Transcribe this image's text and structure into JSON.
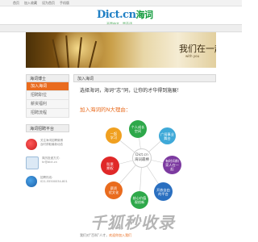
{
  "topnav": {
    "items": [
      "首页",
      "加入收藏",
      "设为首页",
      "手机版"
    ]
  },
  "logo": {
    "wordmark": "Dict.cn",
    "wordmark_cn": "海词",
    "tagline": "不是中文，是英语"
  },
  "banner": {
    "title": "我们在一起",
    "subtitle": "with you"
  },
  "sidebar": {
    "title": "海词博士",
    "items": [
      {
        "label": "加入海词",
        "active": true
      },
      {
        "label": "招聘职位",
        "active": false
      },
      {
        "label": "薪资福利",
        "active": false
      },
      {
        "label": "招聘流程",
        "active": false
      }
    ],
    "platform_title": "海词招聘平台",
    "contacts": [
      {
        "icon": "weibo-icon",
        "color": "#e02828",
        "lines": [
          "关注海词招聘微博",
          "及时获取最新动态"
        ]
      },
      {
        "icon": "mail-icon",
        "color": "#3b8fd4",
        "lines": [
          "简历投递方式：",
          "hr@dict.cn"
        ]
      },
      {
        "icon": "phone-icon",
        "color": "#1f72c2",
        "lines": [
          "招聘热线：",
          "021-55500034-801"
        ]
      }
    ]
  },
  "content": {
    "header": "加入海词",
    "headline": "选择海词，海词“志”同，让你的才华得到施展！",
    "subheadline": "加入海词的N大理由：",
    "hub": "Dict.cn\n海词最棒",
    "nodes": [
      {
        "label": "个人成长\n空间",
        "color": "#2ea84a"
      },
      {
        "label": "广阔事业\n舞台",
        "color": "#3fa9d8"
      },
      {
        "label": "有时间和\n家人在一起",
        "color": "#7c3aa0"
      },
      {
        "label": "开放自由\n的平台",
        "color": "#2a6fc0"
      },
      {
        "label": "核心价值\n观创新",
        "color": "#2ea84a"
      },
      {
        "label": "薪资\n优文化",
        "color": "#e96b1e"
      },
      {
        "label": "股票\n期权",
        "color": "#e02828"
      },
      {
        "label": "一起\n学习",
        "color": "#f0a020"
      }
    ],
    "footer_text": "我们对“百科”人才，",
    "footer_link": "欢迎你加入我们"
  },
  "watermark": "千狐秒收录"
}
